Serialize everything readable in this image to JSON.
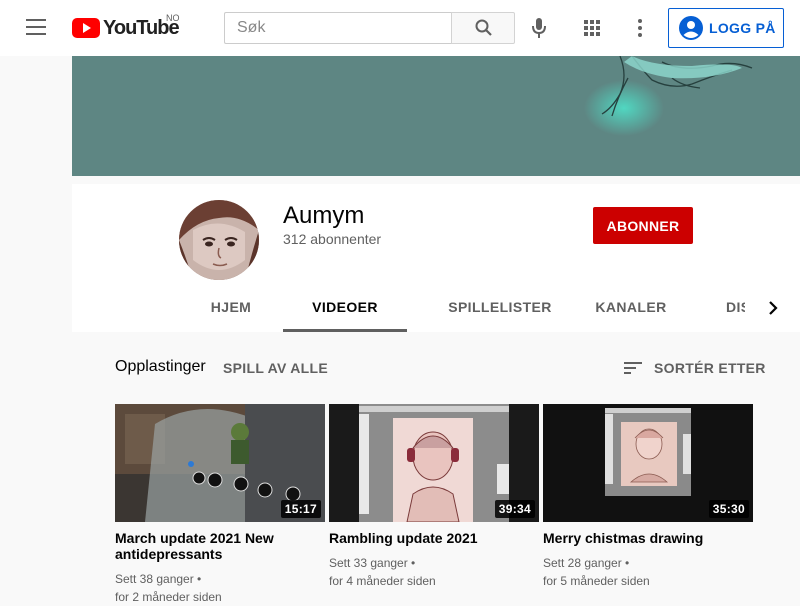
{
  "header": {
    "logo_text": "YouTube",
    "country_code": "NO",
    "search_placeholder": "Søk",
    "signin_label": "LOGG PÅ"
  },
  "channel": {
    "name": "Aumym",
    "subscribers": "312 abonnenter",
    "subscribe_label": "ABONNER"
  },
  "tabs": [
    {
      "label": "HJEM",
      "active": false
    },
    {
      "label": "VIDEOER",
      "active": true
    },
    {
      "label": "SPILLELISTER",
      "active": false
    },
    {
      "label": "KANALER",
      "active": false
    },
    {
      "label": "DISKUSJON",
      "active": false
    }
  ],
  "shelf": {
    "title": "Opplastinger",
    "play_all": "SPILL AV ALLE",
    "sort_label": "SORTÉR ETTER"
  },
  "videos": [
    {
      "title": "March update 2021 New antidepressants",
      "duration": "15:17",
      "views": "Sett 38 ganger •",
      "age": "for 2 måneder siden"
    },
    {
      "title": "Rambling update 2021",
      "duration": "39:34",
      "views": "Sett 33 ganger •",
      "age": "for 4 måneder siden"
    },
    {
      "title": "Merry chistmas drawing",
      "duration": "35:30",
      "views": "Sett 28 ganger •",
      "age": "for 5 måneder siden"
    }
  ],
  "colors": {
    "brand_red": "#ff0000",
    "subscribe_red": "#cc0000",
    "link_blue": "#065fd4",
    "banner": "#5e8683"
  },
  "icons": [
    "menu-icon",
    "search-icon",
    "mic-icon",
    "apps-icon",
    "more-vert-icon",
    "account-icon",
    "chevron-right-icon",
    "sort-icon"
  ]
}
